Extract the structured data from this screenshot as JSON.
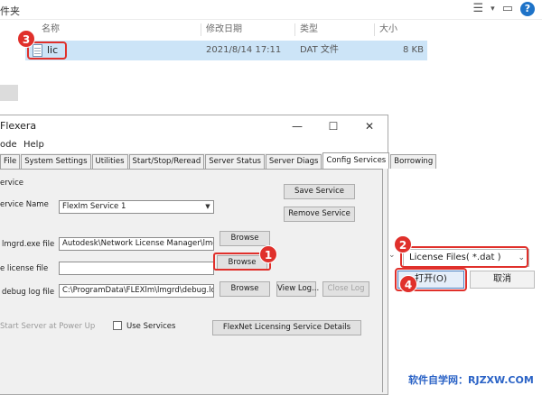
{
  "explorer": {
    "title_fragment": "件夹",
    "columns": {
      "name": "名称",
      "modified": "修改日期",
      "type": "类型",
      "size": "大小"
    },
    "file": {
      "name": "lic",
      "modified": "2021/8/14 17:11",
      "type": "DAT 文件",
      "size": "8 KB"
    },
    "toolbar_icons": [
      "view-list-icon",
      "chevron-down-icon",
      "pane-icon",
      "help-icon"
    ],
    "help_label": "?"
  },
  "open_dialog": {
    "filter_value": "License Files( *.dat )",
    "open_label": "打开(O)",
    "cancel_label": "取消"
  },
  "flexera": {
    "title": "Flexera",
    "menu": [
      "ode",
      "Help"
    ],
    "tabs": [
      "File",
      "System Settings",
      "Utilities",
      "Start/Stop/Reread",
      "Server Status",
      "Server Diags",
      "Config Services",
      "Borrowing"
    ],
    "active_tab": "Config Services",
    "section_label": "ervice",
    "service_name_label": "ervice Name",
    "service_name_value": "FlexIm Service 1",
    "lmgrd_label": "lmgrd.exe file",
    "lmgrd_value": "Autodesk\\Network License Manager\\lmgrd.exe",
    "license_label": "e license file",
    "license_value": "",
    "debug_label": "debug log file",
    "debug_value": "C:\\ProgramData\\FLEXlm\\lmgrd\\debug.log",
    "save_service": "Save Service",
    "remove_service": "Remove Service",
    "browse": "Browse",
    "view_log": "View Log...",
    "close_log": "Close Log",
    "start_at_powerup": "Start Server at Power Up",
    "use_services": "Use Services",
    "flexnet_details": "FlexNet Licensing Service Details"
  },
  "badges": {
    "one": "1",
    "two": "2",
    "three": "3",
    "four": "4"
  },
  "watermark": "软件自学网：RJZXW.COM",
  "colors": {
    "highlight": "#e0302b",
    "selection": "#cce4f7",
    "watermark": "#2b63c6"
  }
}
